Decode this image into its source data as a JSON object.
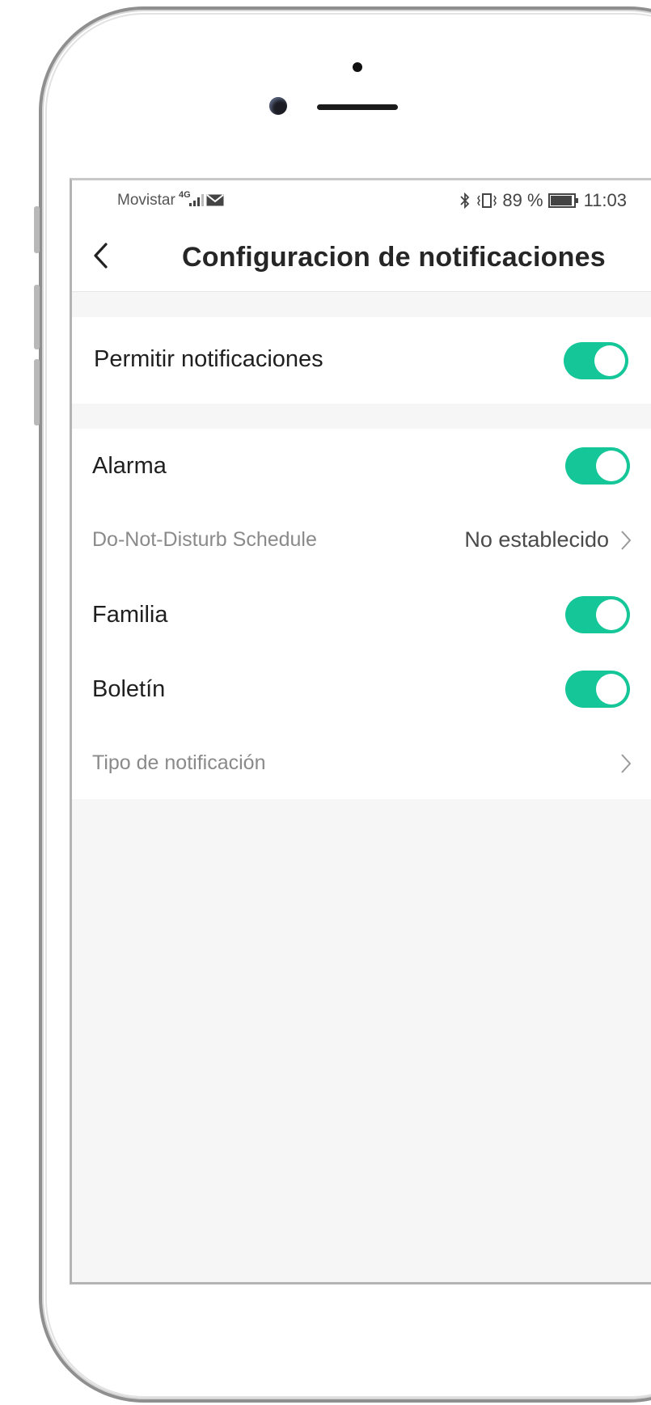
{
  "status_bar": {
    "carrier": "Movistar",
    "network": "4G",
    "battery_percent": "89 %",
    "time": "11:03"
  },
  "header": {
    "title": "Configuracion de notificaciones"
  },
  "allow_section": {
    "label": "Permitir notificaciones",
    "enabled": true
  },
  "settings": {
    "alarm": {
      "label": "Alarma",
      "enabled": true
    },
    "dnd": {
      "label": "Do-Not-Disturb Schedule",
      "value": "No establecido"
    },
    "family": {
      "label": "Familia",
      "enabled": true
    },
    "bulletin": {
      "label": "Boletín",
      "enabled": true
    },
    "notification_type": {
      "label": "Tipo de notificación"
    }
  },
  "colors": {
    "toggle_on": "#14c698",
    "background": "#f6f6f6"
  },
  "icons": [
    "back-icon",
    "chevron-right-icon",
    "bluetooth-icon",
    "vibrate-icon",
    "battery-icon",
    "mail-icon",
    "signal-icon"
  ]
}
